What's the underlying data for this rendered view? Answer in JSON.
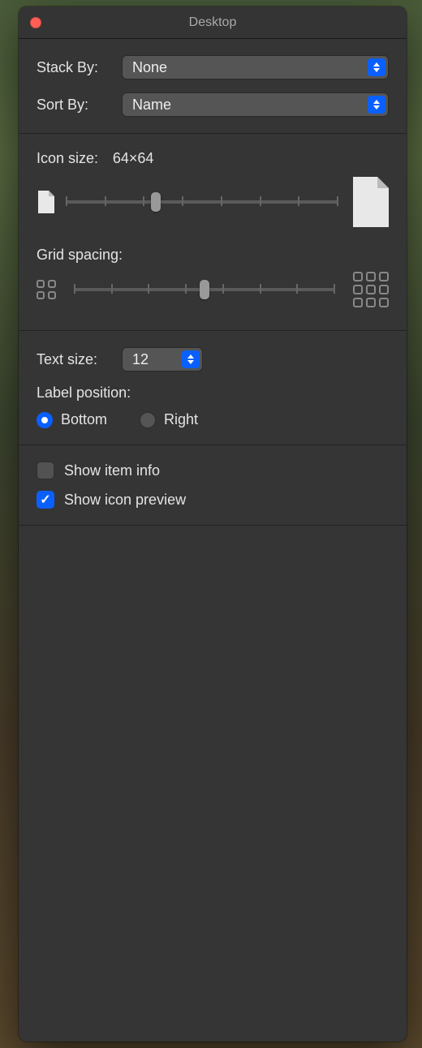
{
  "window": {
    "title": "Desktop"
  },
  "stack": {
    "label": "Stack By:",
    "value": "None"
  },
  "sort": {
    "label": "Sort By:",
    "value": "Name"
  },
  "icon_size": {
    "label": "Icon size:",
    "value_text": "64×64",
    "slider_percent": 33
  },
  "grid_spacing": {
    "label": "Grid spacing:",
    "slider_percent": 50
  },
  "text_size": {
    "label": "Text size:",
    "value": "12"
  },
  "label_position": {
    "label": "Label position:",
    "options": {
      "bottom": "Bottom",
      "right": "Right"
    },
    "selected": "bottom"
  },
  "show_item_info": {
    "label": "Show item info",
    "checked": false
  },
  "show_icon_preview": {
    "label": "Show icon preview",
    "checked": true
  }
}
